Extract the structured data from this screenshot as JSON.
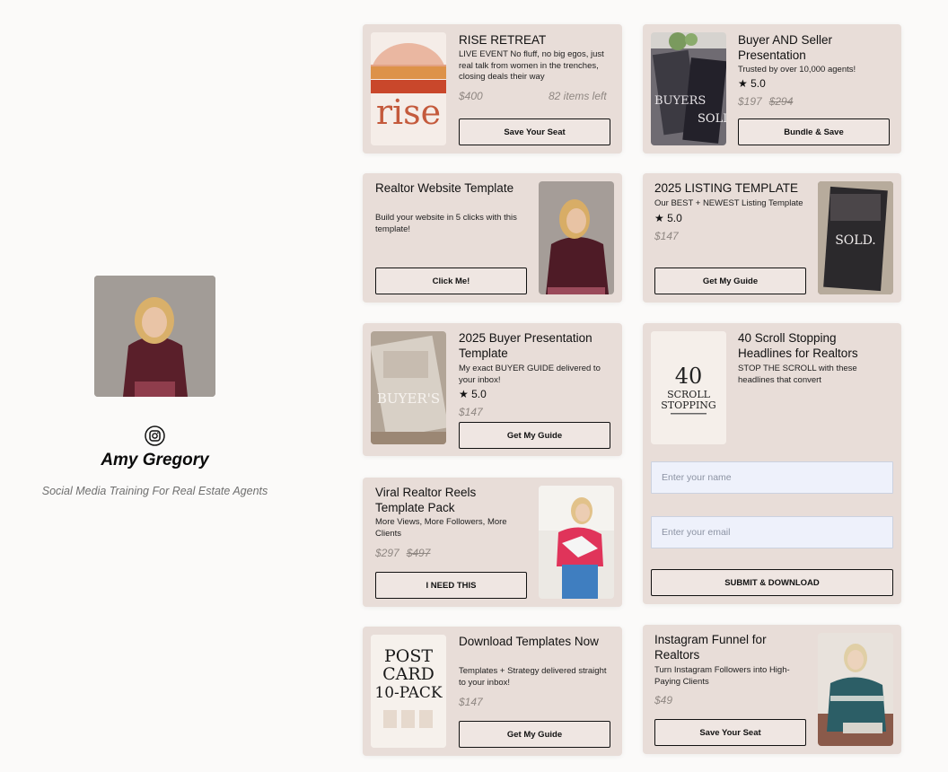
{
  "profile": {
    "name": "Amy Gregory",
    "tagline": "Social Media Training For Real Estate Agents"
  },
  "cards": {
    "rise": {
      "title": "RISE RETREAT",
      "description": "LIVE EVENT No fluff, no big egos, just real talk from women in the trenches, closing deals their way",
      "price": "$400",
      "stock": "82 items left",
      "button": "Save Your Seat",
      "thumb_text": "rise"
    },
    "buyer_seller": {
      "title": "Buyer AND Seller Presentation",
      "description": "Trusted by over 10,000 agents!",
      "rating": "5.0",
      "price": "$197",
      "old_price": "$294",
      "button": "Bundle & Save",
      "thumb_text": "BUYERS",
      "thumb_text2": "SOLD"
    },
    "website": {
      "title": "Realtor Website Template",
      "description": "Build your website in 5 clicks with this template!",
      "button": "Click Me!"
    },
    "listing": {
      "title": "2025 LISTING TEMPLATE",
      "description": "Our BEST + NEWEST Listing Template",
      "rating": "5.0",
      "price": "$147",
      "button": "Get My Guide",
      "thumb_text": "SOLD."
    },
    "buyer_pres": {
      "title": "2025 Buyer Presentation Template",
      "description": "My exact BUYER GUIDE delivered to your inbox!",
      "rating": "5.0",
      "price": "$147",
      "button": "Get My Guide",
      "thumb_text": "BUYER'S"
    },
    "headlines": {
      "title": "40 Scroll Stopping Headlines for Realtors",
      "description": "STOP THE SCROLL with these headlines that convert",
      "name_placeholder": "Enter your name",
      "email_placeholder": "Enter your email",
      "button": "SUBMIT & DOWNLOAD",
      "thumb_num": "40",
      "thumb_line1": "SCROLL",
      "thumb_line2": "STOPPING"
    },
    "reels": {
      "title": "Viral Realtor Reels Template Pack",
      "description": "More Views, More Followers, More Clients",
      "price": "$297",
      "old_price": "$497",
      "button": "I NEED THIS"
    },
    "download": {
      "title": "Download Templates Now",
      "description": "Templates + Strategy delivered straight to your inbox!",
      "price": "$147",
      "button": "Get My Guide",
      "thumb_line1": "POST",
      "thumb_line2": "CARD",
      "thumb_line3": "10-PACK"
    },
    "instagram": {
      "title": "Instagram Funnel for Realtors",
      "description": "Turn Instagram Followers into High-Paying Clients",
      "price": "$49",
      "button": "Save Your Seat"
    }
  },
  "colors": {
    "card_bg": "#e8ddd8",
    "page_bg": "#fbfaf9",
    "price_text": "#8f8782",
    "input_bg": "#eef1fb"
  },
  "icons": {
    "instagram": "instagram-icon",
    "star": "star-icon"
  }
}
